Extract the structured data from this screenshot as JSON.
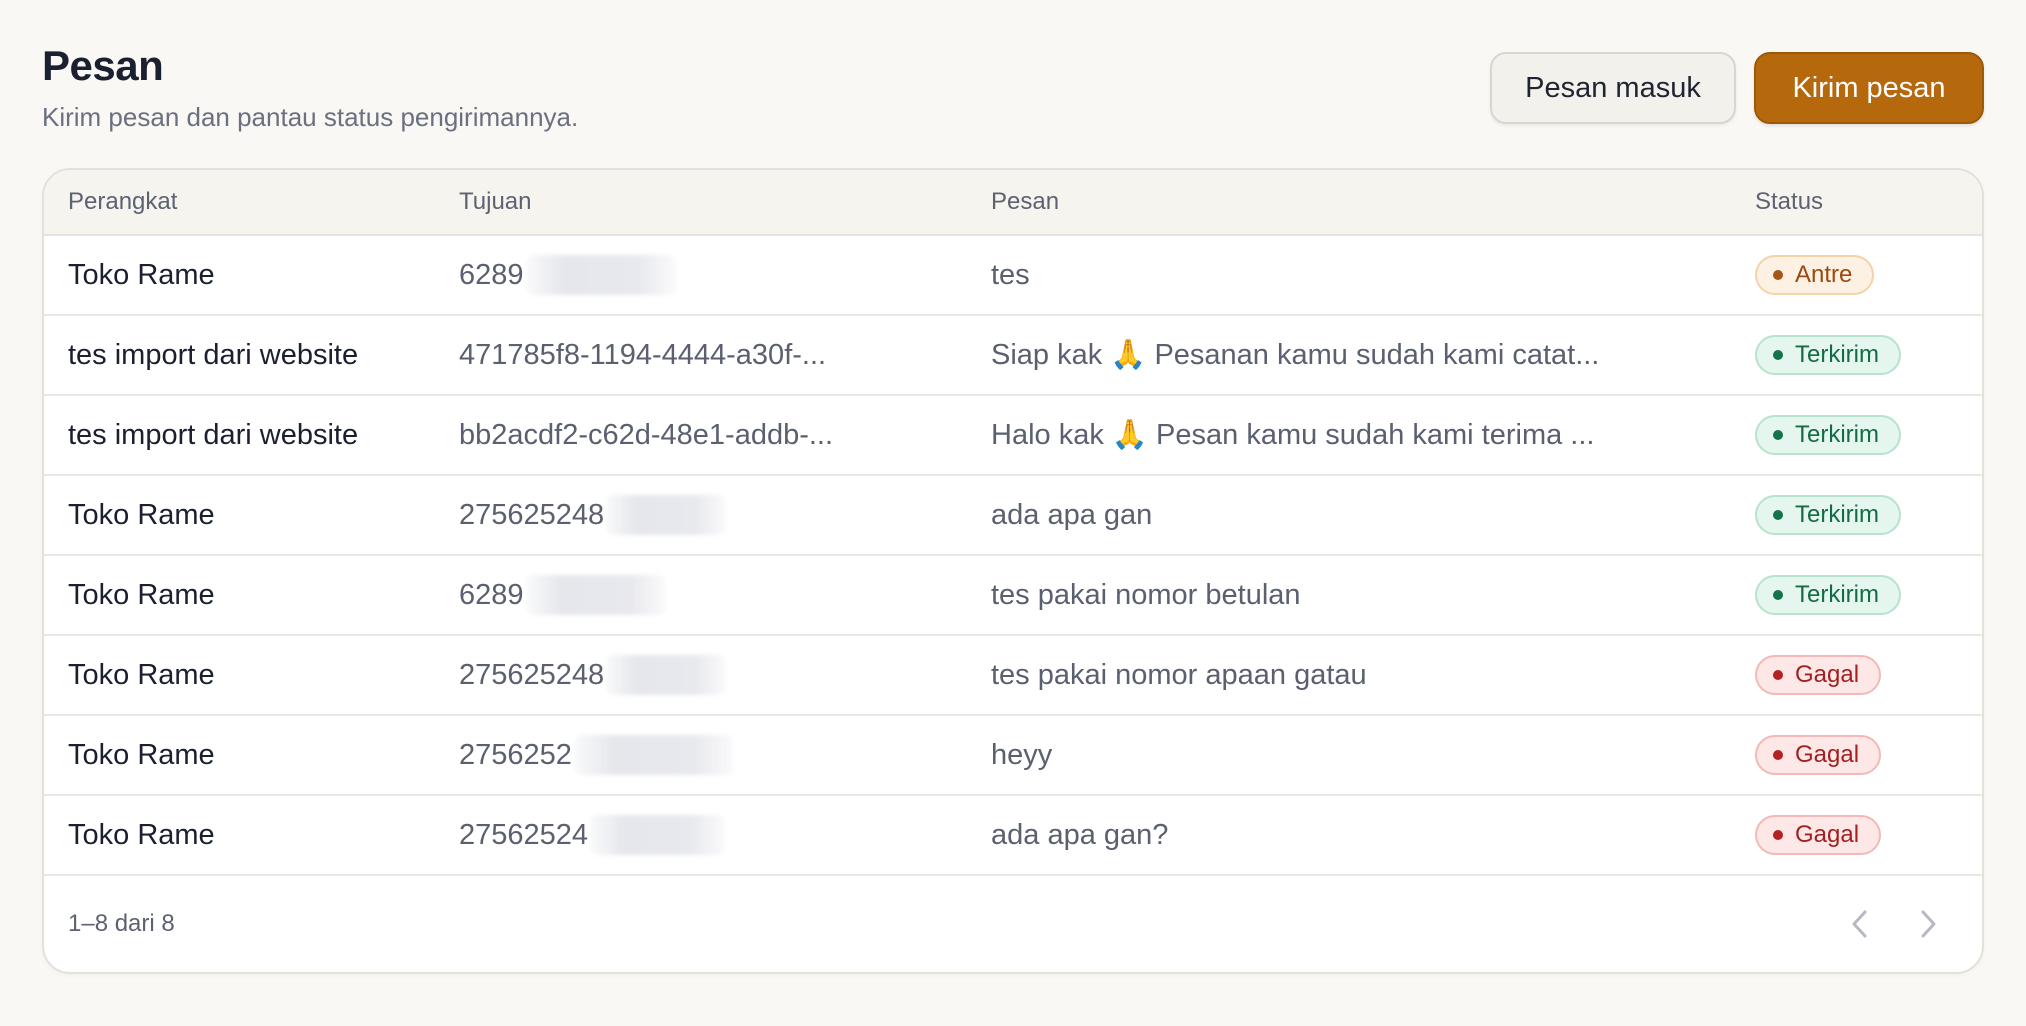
{
  "header": {
    "title": "Pesan",
    "subtitle": "Kirim pesan dan pantau status pengirimannya."
  },
  "actions": {
    "inbox_label": "Pesan masuk",
    "send_label": "Kirim pesan"
  },
  "table": {
    "columns": {
      "device": "Perangkat",
      "recipient": "Tujuan",
      "message": "Pesan",
      "status": "Status"
    },
    "rows": [
      {
        "device": "Toko Rame",
        "recipient": "6289",
        "message": "tes",
        "status": "Antre",
        "status_type": "antre"
      },
      {
        "device": "tes import dari website",
        "recipient": "471785f8-1194-4444-a30f-...",
        "message": "Siap kak 🙏 Pesanan kamu sudah kami catat...",
        "status": "Terkirim",
        "status_type": "terkirim"
      },
      {
        "device": "tes import dari website",
        "recipient": "bb2acdf2-c62d-48e1-addb-...",
        "message": "Halo kak 🙏 Pesan kamu sudah kami terima ...",
        "status": "Terkirim",
        "status_type": "terkirim"
      },
      {
        "device": "Toko Rame",
        "recipient": "275625248",
        "message": "ada apa gan",
        "status": "Terkirim",
        "status_type": "terkirim"
      },
      {
        "device": "Toko Rame",
        "recipient": "6289",
        "message": "tes pakai nomor betulan",
        "status": "Terkirim",
        "status_type": "terkirim"
      },
      {
        "device": "Toko Rame",
        "recipient": "275625248",
        "message": "tes pakai nomor apaan gatau",
        "status": "Gagal",
        "status_type": "gagal"
      },
      {
        "device": "Toko Rame",
        "recipient": "2756252",
        "message": "heyy",
        "status": "Gagal",
        "status_type": "gagal"
      },
      {
        "device": "Toko Rame",
        "recipient": "27562524",
        "message": "ada apa gan?",
        "status": "Gagal",
        "status_type": "gagal"
      }
    ]
  },
  "footer": {
    "range_text": "1–8 dari 8",
    "prev_icon": "chevron-left-icon",
    "next_icon": "chevron-right-icon"
  },
  "colors": {
    "background": "#faf8f4",
    "primary": "#b5690c",
    "antre": "#9a4a10",
    "terkirim": "#146b46",
    "gagal": "#a32020"
  }
}
